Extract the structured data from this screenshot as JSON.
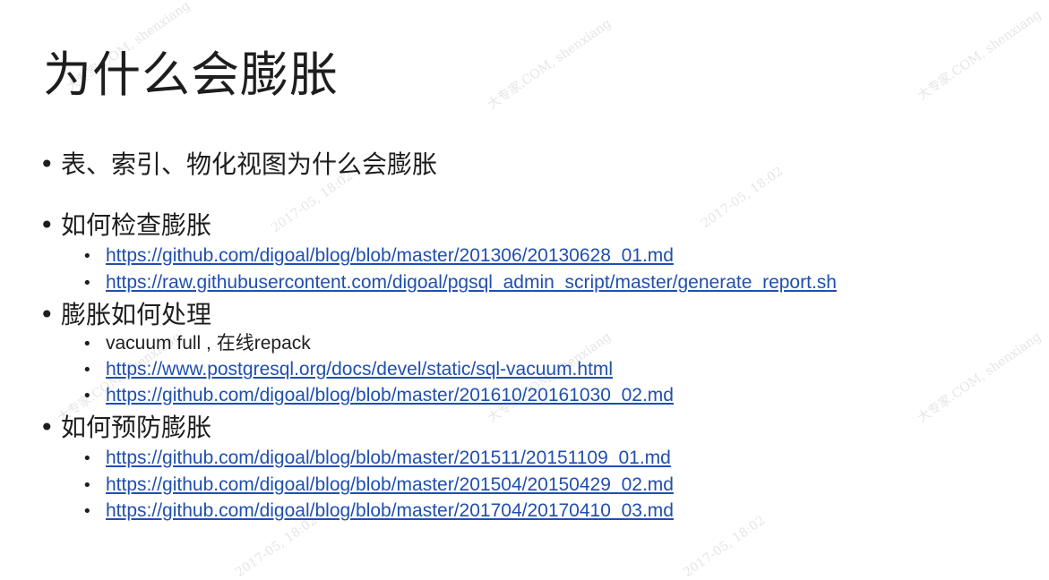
{
  "title": "为什么会膨胀",
  "bullets": {
    "b1": "表、索引、物化视图为什么会膨胀",
    "b2": "如何检查膨胀",
    "b2_links": [
      "https://github.com/digoal/blog/blob/master/201306/20130628_01.md",
      "https://raw.githubusercontent.com/digoal/pgsql_admin_script/master/generate_report.sh"
    ],
    "b3": "膨胀如何处理",
    "b3_text": "vacuum full , 在线repack",
    "b3_links": [
      "https://www.postgresql.org/docs/devel/static/sql-vacuum.html",
      "https://github.com/digoal/blog/blob/master/201610/20161030_02.md"
    ],
    "b4": "如何预防膨胀",
    "b4_links": [
      "https://github.com/digoal/blog/blob/master/201511/20151109_01.md",
      "https://github.com/digoal/blog/blob/master/201504/20150429_02.md",
      "https://github.com/digoal/blog/blob/master/201704/20170410_03.md"
    ]
  },
  "bullet_glyph": "•",
  "watermark": {
    "a": "大专家.COM, shenxiang",
    "b": "2017-05, 18:02"
  },
  "colors": {
    "link": "#1f4fb0",
    "text": "#1e1e1e"
  }
}
